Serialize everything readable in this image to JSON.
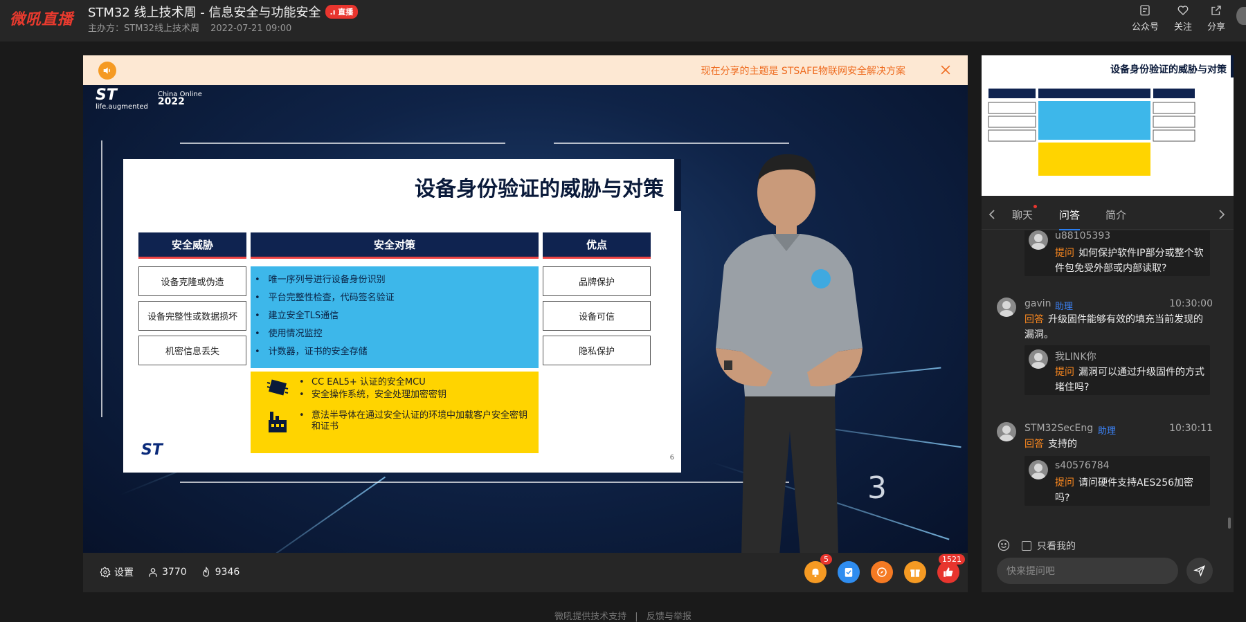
{
  "header": {
    "logo": "微吼直播",
    "title": "STM32 线上技术周 - 信息安全与功能安全",
    "live_badge": "直播",
    "host_label": "主办方：STM32线上技术周",
    "datetime": "2022-07-21 09:00",
    "actions": [
      {
        "label": "公众号",
        "icon": "qrcode-icon"
      },
      {
        "label": "关注",
        "icon": "heart-plus-icon"
      },
      {
        "label": "分享",
        "icon": "share-icon"
      }
    ]
  },
  "notice": {
    "text": "现在分享的主题是 STSAFE物联网安全解决方案"
  },
  "slide": {
    "title": "设备身份验证的威胁与对策",
    "headers": [
      "安全威胁",
      "安全对策",
      "优点"
    ],
    "threats": [
      "设备克隆或伪造",
      "设备完整性或数据损坏",
      "机密信息丢失"
    ],
    "measures": [
      "唯一序列号进行设备身份识别",
      "平台完整性检查，代码签名验证",
      "建立安全TLS通信",
      "使用情况监控",
      "计数器，证书的安全存储"
    ],
    "hardware": [
      "CC EAL5+ 认证的安全MCU",
      "安全操作系统，安全处理加密密钥",
      "意法半导体在通过安全认证的环境中加载客户安全密钥和证书"
    ],
    "benefits": [
      "品牌保护",
      "设备可信",
      "隐私保护"
    ],
    "page_number": "6",
    "brand": "ST",
    "brand_tagline": "life.augmented",
    "event_mark_1": "China Online",
    "event_mark_2": "2022",
    "overlay_number": "3"
  },
  "player_bar": {
    "settings_label": "设置",
    "viewers": "3770",
    "heat": "9346",
    "notify_badge": "5",
    "like_badge": "1521",
    "buttons": [
      {
        "icon": "bell-icon",
        "color": "#f59a23"
      },
      {
        "icon": "checklist-icon",
        "color": "#2f8df0"
      },
      {
        "icon": "compass-icon",
        "color": "#f57a23"
      },
      {
        "icon": "gift-icon",
        "color": "#f59a23"
      },
      {
        "icon": "thumbs-up-icon",
        "color": "#e8352e"
      }
    ]
  },
  "sidebar": {
    "thumb_title": "设备身份验证的威胁与对策",
    "tabs": [
      "聊天",
      "问答",
      "简介"
    ],
    "active_tab": "问答",
    "messages": [
      {
        "type": "question",
        "user": "u88105393",
        "label": "提问",
        "text": "如何保护软件IP部分或整个软件包免受外部或内部读取?"
      },
      {
        "type": "answer",
        "user": "gavin",
        "role": "助理",
        "time": "10:30:00",
        "label": "回答",
        "text": "升级固件能够有效的填充当前发现的漏洞。",
        "question": {
          "user": "我LINK你",
          "label": "提问",
          "text": "漏洞可以通过升级固件的方式堵住吗?"
        }
      },
      {
        "type": "answer",
        "user": "STM32SecEng",
        "role": "助理",
        "time": "10:30:11",
        "label": "回答",
        "text": "支持的",
        "question": {
          "user": "s40576784",
          "label": "提问",
          "text": "请问硬件支持AES256加密吗?"
        }
      }
    ],
    "only_mine_label": "只看我的",
    "input_placeholder": "快来提问吧"
  },
  "footer": {
    "support": "微吼提供技术支持",
    "separator": "|",
    "report": "反馈与举报"
  }
}
